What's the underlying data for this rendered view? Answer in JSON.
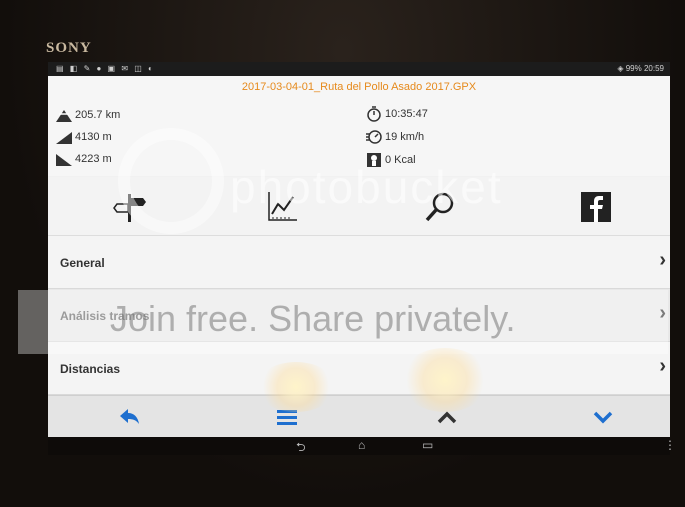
{
  "device": {
    "brand": "SONY"
  },
  "statusbar": {
    "time": "20:59",
    "battery": "99%",
    "left_icons": "▤ ◧ ✎ ● ▣ ✉ ◫ ◐"
  },
  "title": "2017-03-04-01_Ruta del Pollo Asado 2017.GPX",
  "stats": {
    "distance": "205.7 km",
    "ascent": "4130 m",
    "descent": "4223 m",
    "duration": "10:35:47",
    "speed": "19 km/h",
    "calories": "0 Kcal"
  },
  "toolbar": [
    "signpost-icon",
    "chart-icon",
    "search-icon",
    "facebook-icon"
  ],
  "list": [
    {
      "label": "General"
    },
    {
      "label": "Análisis tramos"
    },
    {
      "label": "Distancias"
    }
  ],
  "chevron": "›",
  "watermark": {
    "brand": "photobucket",
    "slogan": "Join free. Share privately."
  },
  "colors": {
    "accent": "#1e6fcf",
    "title": "#e68a1c"
  }
}
